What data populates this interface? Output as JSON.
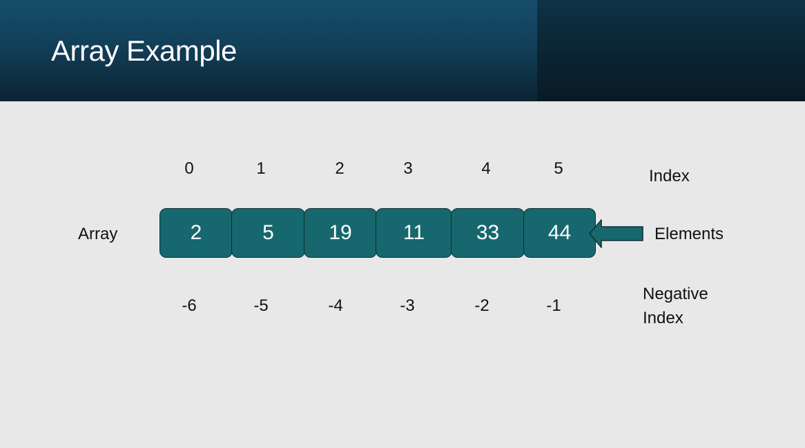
{
  "slide": {
    "title": "Array Example"
  },
  "labels": {
    "array": "Array",
    "index": "Index",
    "elements": "Elements",
    "negative_index_line1": "Negative",
    "negative_index_line2": "Index"
  },
  "diagram": {
    "indices": [
      "0",
      "1",
      "2",
      "3",
      "4",
      "5"
    ],
    "elements": [
      "2",
      "5",
      "19",
      "11",
      "33",
      "44"
    ],
    "negative_indices": [
      "-6",
      "-5",
      "-4",
      "-3",
      "-2",
      "-1"
    ],
    "colors": {
      "cell_fill": "#17686e",
      "cell_border": "#0d2f33",
      "cell_text": "#ffffff",
      "header_bg": "#164d6b",
      "slide_bg": "#e8e8e8"
    },
    "arrow": {
      "icon": "left-arrow-icon",
      "points_to": "elements"
    }
  }
}
